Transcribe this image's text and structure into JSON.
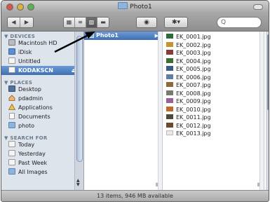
{
  "window": {
    "title": "Photo1"
  },
  "toolbar": {
    "back_glyph": "◀",
    "forward_glyph": "▶",
    "view_modes": [
      "icon-view",
      "list-view",
      "column-view",
      "coverflow-view"
    ],
    "view_glyphs": [
      "▦",
      "≡",
      "▥",
      "▬"
    ],
    "active_view": "column-view",
    "quicklook_glyph": "◉",
    "action_glyph": "✱▾",
    "search_glyph": "Q"
  },
  "sidebar": {
    "devices_header": "▼ DEVICES",
    "devices": [
      {
        "label": "Macintosh HD",
        "icon": "disk-icon"
      },
      {
        "label": "iDisk",
        "icon": "idisk-icon"
      },
      {
        "label": "Untitled",
        "icon": "disk-icon"
      },
      {
        "label": "KODAKSCN",
        "icon": "removable-disk-icon",
        "selected": true,
        "eject": "⏏"
      }
    ],
    "places_header": "▼ PLACES",
    "places": [
      {
        "label": "Desktop",
        "icon": "desktop-icon"
      },
      {
        "label": "pdadmin",
        "icon": "home-icon"
      },
      {
        "label": "Applications",
        "icon": "applications-icon"
      },
      {
        "label": "Documents",
        "icon": "documents-icon"
      },
      {
        "label": "photo",
        "icon": "folder-icon"
      }
    ],
    "search_header": "▼ SEARCH FOR",
    "searches": [
      {
        "label": "Today",
        "icon": "clock-icon"
      },
      {
        "label": "Yesterday",
        "icon": "clock-icon"
      },
      {
        "label": "Past Week",
        "icon": "clock-icon"
      },
      {
        "label": "All Images",
        "icon": "images-icon"
      }
    ]
  },
  "column1": {
    "items": [
      {
        "label": "Photo1",
        "selected": true,
        "arrow": "▶"
      }
    ]
  },
  "column2": {
    "files": [
      {
        "name": "EK_0001.jpg",
        "color": "#2f6b3a"
      },
      {
        "name": "EK_0002.jpg",
        "color": "#c7922f"
      },
      {
        "name": "EK_0003.jpg",
        "color": "#8a3a3a"
      },
      {
        "name": "EK_0004.jpg",
        "color": "#3d6e2e"
      },
      {
        "name": "EK_0005.jpg",
        "color": "#3b5a86"
      },
      {
        "name": "EK_0006.jpg",
        "color": "#5f7fa8"
      },
      {
        "name": "EK_0007.jpg",
        "color": "#8c6a3b"
      },
      {
        "name": "EK_0008.jpg",
        "color": "#7a7a6c"
      },
      {
        "name": "EK_0009.jpg",
        "color": "#9b5f9a"
      },
      {
        "name": "EK_0010.jpg",
        "color": "#c06a2e"
      },
      {
        "name": "EK_0011.jpg",
        "color": "#4b4b3a"
      },
      {
        "name": "EK_0012.jpg",
        "color": "#6b4a2e"
      },
      {
        "name": "EK_0013.jpg",
        "color": "#e9e9e9"
      }
    ]
  },
  "status": {
    "text": "13 items, 946 MB available"
  }
}
